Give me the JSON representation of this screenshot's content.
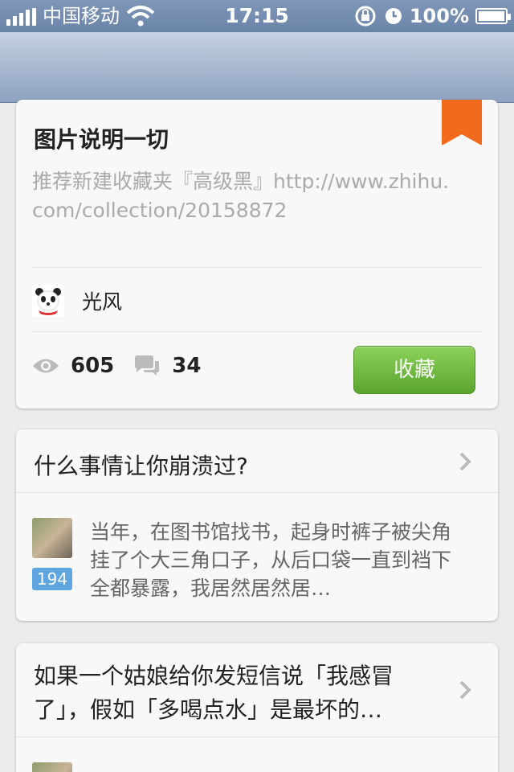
{
  "status_bar": {
    "carrier": "中国移动",
    "time": "17:15",
    "battery": "100%"
  },
  "collection": {
    "title": "图片说明一切",
    "description": "推荐新建收藏夹『高级黑』http://www.zhihu.com/collection/20158872",
    "owner": "光风",
    "views": "605",
    "comments": "34",
    "collect_label": "收藏"
  },
  "feed": [
    {
      "question": "什么事情让你崩溃过?",
      "votes": "194",
      "answer": "当年，在图书馆找书，起身时裤子被尖角挂了个大三角口子，从后口袋一直到裆下全都暴露，我居然居然居…"
    },
    {
      "question": "如果一个姑娘给你发短信说「我感冒了」，假如「多喝点水」是最坏的…"
    }
  ],
  "colors": {
    "accent_green": "#6bb63a",
    "bookmark_orange": "#f26b1d",
    "badge_blue": "#5fa5e0"
  }
}
